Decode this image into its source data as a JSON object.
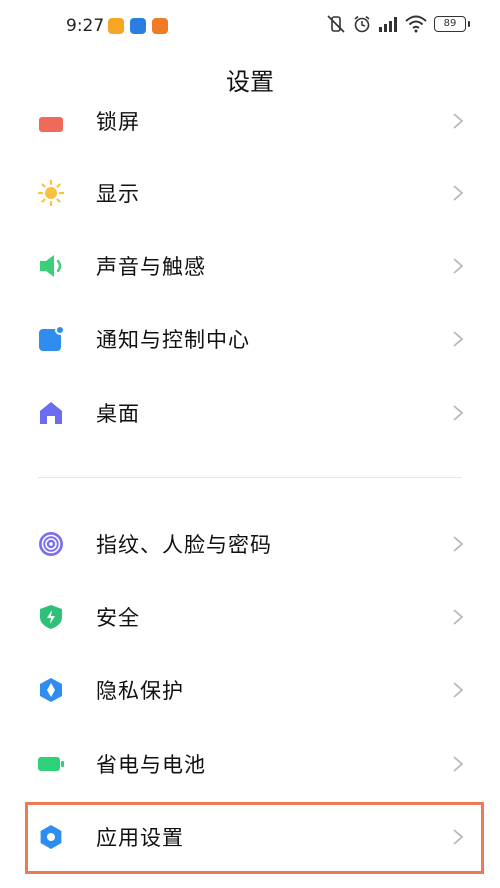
{
  "status_bar": {
    "time": "9:27",
    "battery": "89",
    "notifications": [
      {
        "icon": "weibo-icon",
        "color": "#f5a623"
      },
      {
        "icon": "app-notification-icon",
        "color": "#2a7de1"
      },
      {
        "icon": "app-notification-icon-2",
        "color": "#f07a26"
      }
    ]
  },
  "header": {
    "title": "设置"
  },
  "items": [
    {
      "label": "锁屏",
      "icon": "lock-screen-icon",
      "color": "#f06a5a"
    },
    {
      "label": "显示",
      "icon": "sun-icon",
      "color": "#f7c23e"
    },
    {
      "label": "声音与触感",
      "icon": "speaker-icon",
      "color": "#3ccf7a"
    },
    {
      "label": "通知与控制中心",
      "icon": "notification-icon",
      "color": "#2f8df0"
    },
    {
      "label": "桌面",
      "icon": "home-icon",
      "color": "#6b6cf0"
    },
    {
      "label": "指纹、人脸与密码",
      "icon": "fingerprint-icon",
      "color": "#7b6ff0"
    },
    {
      "label": "安全",
      "icon": "shield-icon",
      "color": "#2fc07a"
    },
    {
      "label": "隐私保护",
      "icon": "privacy-icon",
      "color": "#2f8df0"
    },
    {
      "label": "省电与电池",
      "icon": "battery-icon",
      "color": "#2fd07a"
    },
    {
      "label": "应用设置",
      "icon": "gear-icon",
      "color": "#2f8df0"
    }
  ],
  "highlight_color": "#ec7a55"
}
